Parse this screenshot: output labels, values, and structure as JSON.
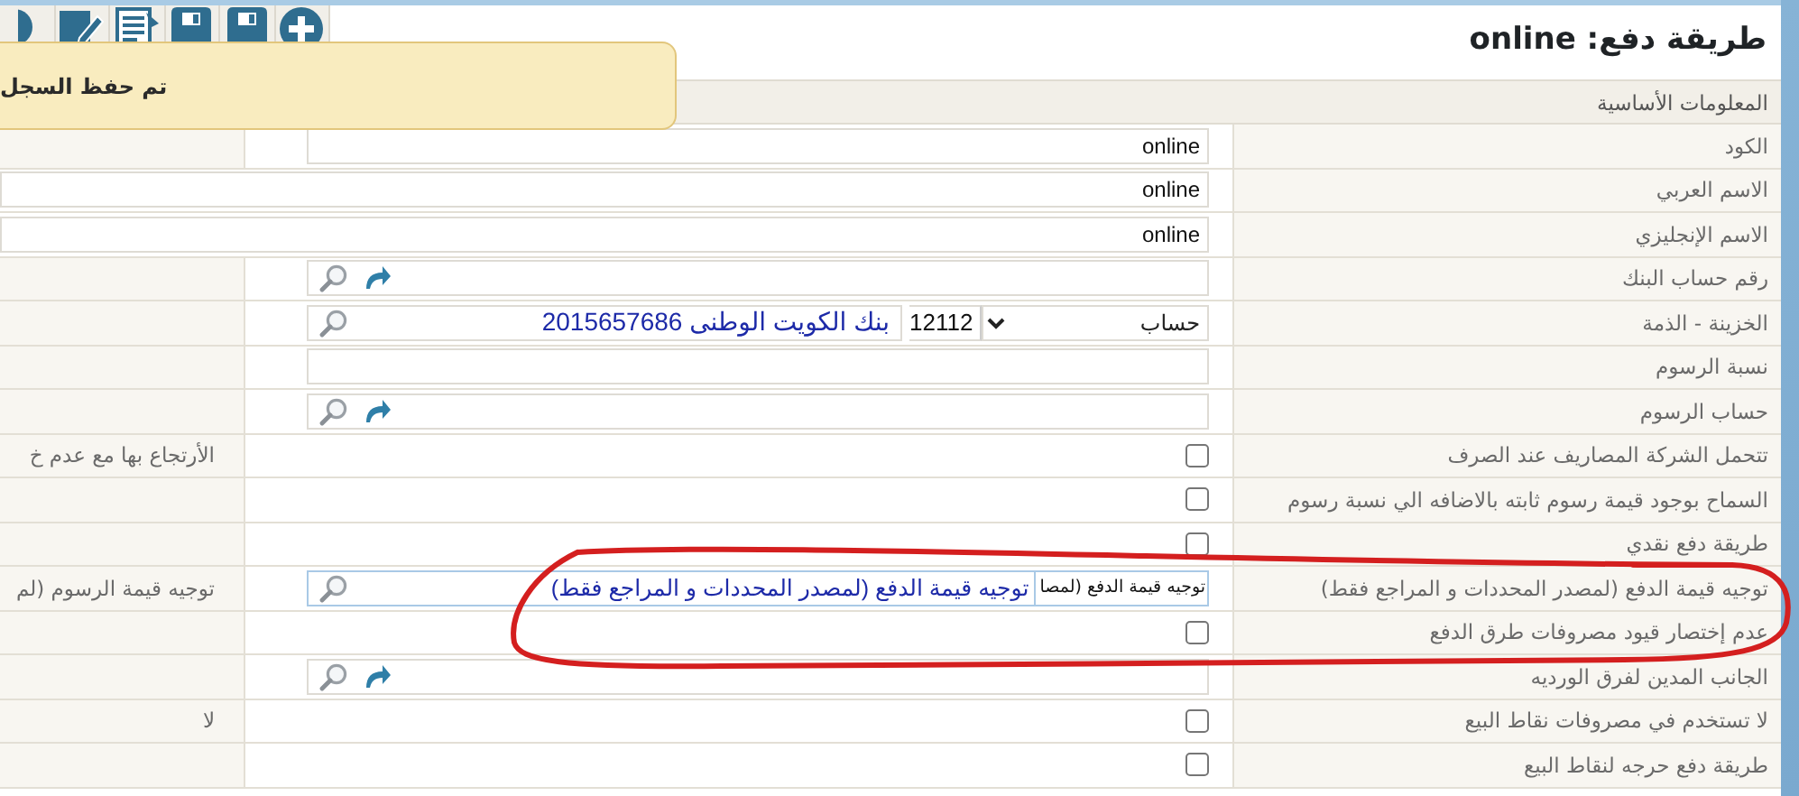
{
  "toolbar": {
    "buttons": [
      {
        "kind": "round"
      },
      {
        "kind": "edit"
      },
      {
        "kind": "list"
      },
      {
        "kind": "save"
      },
      {
        "kind": "save"
      },
      {
        "kind": "add"
      }
    ]
  },
  "title": "طريقة دفع: online",
  "toast": {
    "message": "تم حفظ السجل"
  },
  "section": {
    "title": "المعلومات الأساسية"
  },
  "rows": [
    {
      "label": "الكود",
      "kind": "text",
      "value": "online"
    },
    {
      "label": "الاسم العربي",
      "kind": "wide-text",
      "value": "online"
    },
    {
      "label": "الاسم الإنجليزي",
      "kind": "wide-text",
      "value": "online"
    },
    {
      "label": "رقم حساب البنك",
      "kind": "lookup"
    },
    {
      "label": "الخزينة - الذمة",
      "kind": "treasury",
      "select": "حساب",
      "code": "12112",
      "value": "بنك الكويت الوطنى 2015657686"
    },
    {
      "label": "نسبة الرسوم",
      "kind": "text"
    },
    {
      "label": "حساب الرسوم",
      "kind": "lookup"
    },
    {
      "label": "تتحمل الشركة المصاريف عند الصرف",
      "kind": "checkbox",
      "checked": false,
      "side_label": "الأرتجاع بها مع عدم خ"
    },
    {
      "label": "السماح بوجود قيمة رسوم ثابته بالاضافه الي نسبة رسوم",
      "kind": "checkbox",
      "checked": false
    },
    {
      "label": "طريقة دفع نقدي",
      "kind": "checkbox",
      "checked": false
    },
    {
      "label": "توجيه قيمة الدفع (لمصدر المحددات و المراجع فقط)",
      "kind": "routing",
      "code": "توجيه قيمة الدفع (لمصا",
      "value": "توجيه قيمة الدفع (لمصدر المحددات و المراجع فقط)",
      "side_label": "توجيه قيمة الرسوم (لم"
    },
    {
      "label": "عدم إختصار قيود مصروفات طرق الدفع",
      "kind": "checkbox",
      "checked": false
    },
    {
      "label": "الجانب المدين لفرق الورديه",
      "kind": "lookup"
    },
    {
      "label": "لا تستخدم في مصروفات نقاط البيع",
      "kind": "checkbox",
      "checked": false,
      "side_label": "لا"
    },
    {
      "label": "طريقة دفع حرجه لنقاط البيع",
      "kind": "checkbox",
      "checked": false
    }
  ],
  "annotation": {
    "kind": "loop"
  }
}
